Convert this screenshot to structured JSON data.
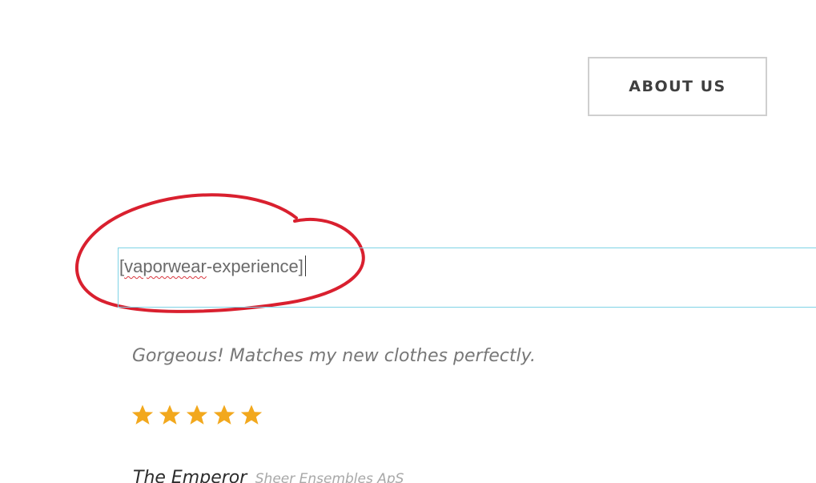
{
  "header": {
    "about_label": "ABOUT US"
  },
  "shortcode": {
    "open_bracket": "[",
    "misspelled": "vaporwear",
    "rest": "-experience]"
  },
  "testimonial": {
    "quote": "Gorgeous! Matches my new clothes perfectly.",
    "rating": 5,
    "rating_max": 5,
    "author_name": "The Emperor",
    "author_company": "Sheer Ensembles ApS"
  },
  "colors": {
    "annotation_red": "#d9202f",
    "star_gold": "#f2a81d",
    "box_border": "#7fd3e6"
  }
}
